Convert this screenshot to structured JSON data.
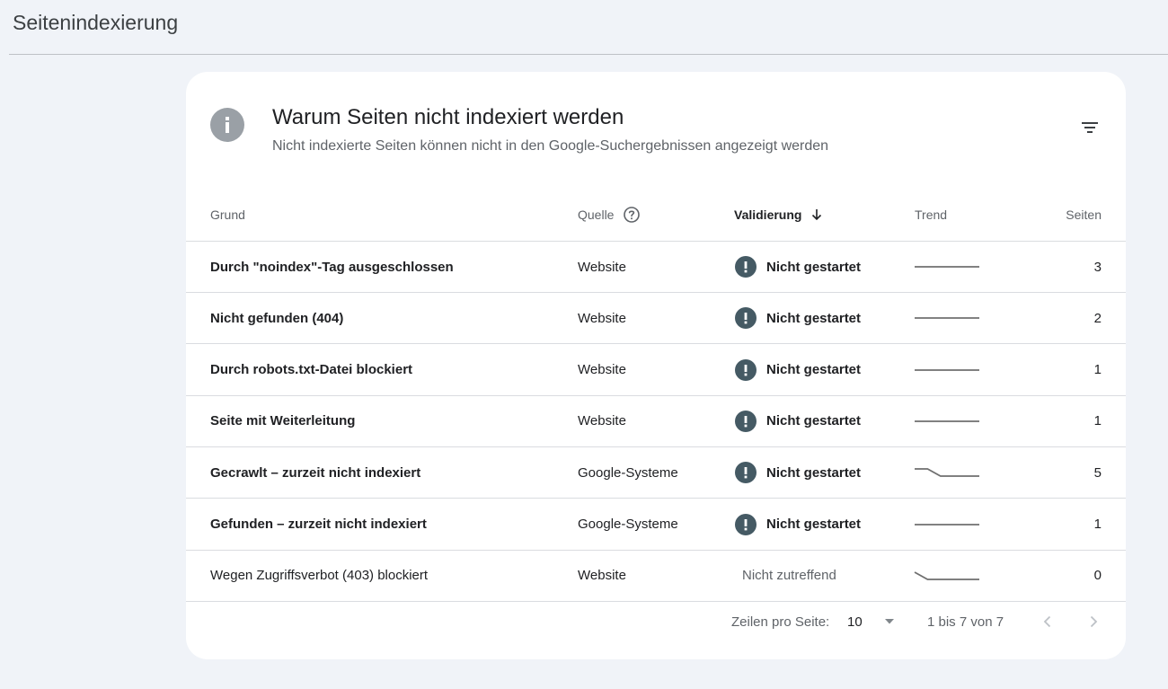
{
  "page": {
    "title": "Seitenindexierung"
  },
  "card": {
    "title": "Warum Seiten nicht indexiert werden",
    "subtitle": "Nicht indexierte Seiten können nicht in den Google-Suchergebnissen angezeigt werden",
    "info_icon": "info-icon",
    "filter_icon": "filter-icon"
  },
  "table": {
    "headers": {
      "reason": "Grund",
      "source": "Quelle",
      "validation": "Validierung",
      "trend": "Trend",
      "pages": "Seiten"
    },
    "rows": [
      {
        "reason": "Durch \"noindex\"-Tag ausgeschlossen",
        "source": "Website",
        "validation": "Nicht gestartet",
        "pages": "3",
        "trend": [
          1,
          1,
          1,
          1,
          1,
          1
        ]
      },
      {
        "reason": "Nicht gefunden (404)",
        "source": "Website",
        "validation": "Nicht gestartet",
        "pages": "2",
        "trend": [
          1,
          1,
          1,
          1,
          1,
          1
        ]
      },
      {
        "reason": "Durch robots.txt-Datei blockiert",
        "source": "Website",
        "validation": "Nicht gestartet",
        "pages": "1",
        "trend": [
          1,
          1,
          1,
          1,
          1,
          1
        ]
      },
      {
        "reason": "Seite mit Weiterleitung",
        "source": "Website",
        "validation": "Nicht gestartet",
        "pages": "1",
        "trend": [
          1,
          1,
          1,
          1,
          1,
          1
        ]
      },
      {
        "reason": "Gecrawlt – zurzeit nicht indexiert",
        "source": "Google-Systeme",
        "validation": "Nicht gestartet",
        "pages": "5",
        "trend": [
          2,
          2,
          1,
          1,
          1,
          1
        ]
      },
      {
        "reason": "Gefunden – zurzeit nicht indexiert",
        "source": "Google-Systeme",
        "validation": "Nicht gestartet",
        "pages": "1",
        "trend": [
          1,
          1,
          1,
          1,
          1,
          1
        ]
      },
      {
        "reason": "Wegen Zugriffsverbot (403) blockiert",
        "source": "Website",
        "validation": "Nicht zutreffend",
        "pages": "0",
        "trend": [
          1,
          0,
          0,
          0,
          0,
          0
        ]
      }
    ]
  },
  "footer": {
    "rows_per_page_label": "Zeilen pro Seite:",
    "rows_per_page_value": "10",
    "range": "1 bis 7 von 7"
  },
  "colors": {
    "status_icon": "#455a64",
    "info_icon": "#9aa0a6",
    "trend_line": "#6f6f6f"
  }
}
